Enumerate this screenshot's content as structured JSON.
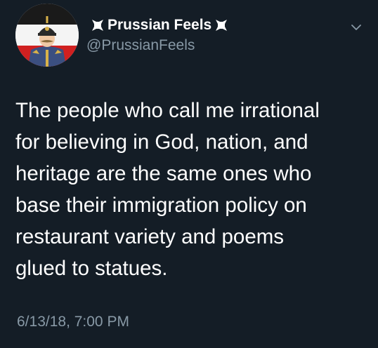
{
  "author": {
    "display_name": "Prussian Feels",
    "handle": "@PrussianFeels",
    "name_prefix_icon": "iron-cross-icon",
    "name_suffix_icon": "iron-cross-icon",
    "avatar_icon": "prussian-soldier-avatar"
  },
  "tweet": {
    "lines": [
      "The people who call me irrational",
      "for believing in God, nation, and",
      "heritage are the same ones who",
      "base their immigration policy on",
      "restaurant variety and poems",
      "glued to statues."
    ],
    "timestamp": "6/13/18, 7:00 PM"
  },
  "menu": {
    "icon": "chevron-down-icon"
  },
  "colors": {
    "background": "#141d26",
    "text": "#ffffff",
    "secondary_text": "#8899a6"
  }
}
